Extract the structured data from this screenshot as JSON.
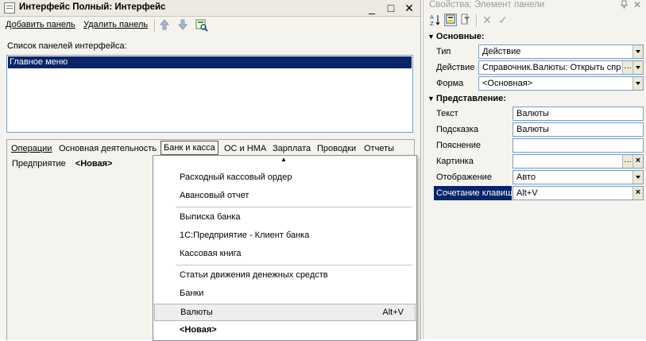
{
  "left_window": {
    "title": "Интерфейс Полный: Интерфейс",
    "controls": {
      "minimize": "_",
      "maximize": "□",
      "close": "✕"
    },
    "toolbar": {
      "add_panel": "Добавить панель",
      "delete_panel": "Удалить панель",
      "icons": [
        "arrow-up-icon",
        "arrow-down-icon",
        "preview-icon"
      ]
    },
    "list_label": "Список панелей интерфейса:",
    "list_items": [
      "Главное меню"
    ],
    "tabs": [
      "Операции",
      "Основная деятельность",
      "Банк и касса",
      "ОС и НМА",
      "Зарплата",
      "Проводки",
      "Отчеты"
    ],
    "active_tab": "Банк и касса",
    "sub_row": {
      "item": "Предприятие",
      "new_label": "<Новая>"
    }
  },
  "menu": {
    "items": [
      "Расходный кассовый ордер",
      "Авансовый отчет",
      "Выписка банка",
      "1С:Предприятие - Клиент банка",
      "Кассовая книга",
      "Статьи движения денежных средств",
      "Банки",
      "Валюты",
      "<Новая>"
    ],
    "highlighted": "Валюты",
    "highlighted_shortcut": "Alt+V"
  },
  "right_window": {
    "title": "Свойства: Элемент панели",
    "controls": {
      "pin": "ꟷ",
      "close": "✕"
    },
    "toolbar_icons": [
      "sort-az-icon",
      "categories-icon",
      "filter-icon",
      "cancel-icon",
      "check-icon"
    ],
    "section_main": "Основные:",
    "section_view": "Представление:",
    "props": {
      "type_label": "Тип",
      "type_value": "Действие",
      "action_label": "Действие",
      "action_value": "Справочник.Валюты: Открыть спр",
      "form_label": "Форма",
      "form_value": "<Основная>",
      "text_label": "Текст",
      "text_value": "Валюты",
      "hint_label": "Подсказка",
      "hint_value": "Валюты",
      "note_label": "Пояснение",
      "note_value": "",
      "picture_label": "Картинка",
      "picture_value": "",
      "display_label": "Отображение",
      "display_value": "Авто",
      "hotkey_label": "Сочетание клавиш",
      "hotkey_value": "Alt+V"
    },
    "colors": {
      "selection": "#0a246a",
      "title_inactive": "#9a9a9a"
    }
  }
}
